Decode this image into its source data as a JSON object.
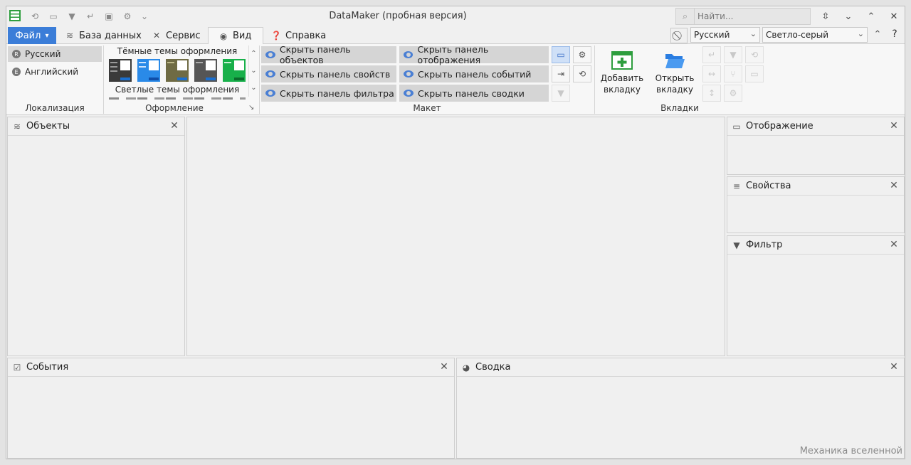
{
  "window": {
    "title": "DataMaker (пробная версия)"
  },
  "quick_access": {
    "icons": [
      "refresh-icon",
      "window-icon",
      "pin-icon",
      "return-icon",
      "chip-icon",
      "gear-icon",
      "chevron-down-icon"
    ]
  },
  "search": {
    "placeholder": "Найти..."
  },
  "menu": {
    "file": "Файл",
    "database": "База данных",
    "service": "Сервис",
    "view": "Вид",
    "help": "Справка"
  },
  "toolbar_right": {
    "language": "Русский",
    "theme": "Светло-серый",
    "help_mark": "?"
  },
  "ribbon": {
    "localization": {
      "label": "Локализация",
      "items": [
        {
          "badge": "R",
          "label": "Русский"
        },
        {
          "badge": "E",
          "label": "Английский"
        }
      ]
    },
    "appearance": {
      "label": "Оформление",
      "dark_title": "Тёмные темы оформления",
      "light_title": "Светлые темы оформления"
    },
    "layout": {
      "label": "Макет",
      "hide_objects": "Скрыть панель объектов",
      "hide_properties": "Скрыть панель свойств",
      "hide_filter": "Скрыть панель фильтра",
      "hide_display": "Скрыть панель отображения",
      "hide_events": "Скрыть панель событий",
      "hide_summary": "Скрыть панель сводки"
    },
    "tabs": {
      "label": "Вкладки",
      "add_tab": "Добавить вкладку",
      "open_tab": "Открыть вкладку"
    }
  },
  "panels": {
    "objects": "Объекты",
    "display": "Отображение",
    "properties": "Свойства",
    "filter": "Фильтр",
    "events": "События",
    "summary": "Сводка"
  },
  "status": {
    "text": "Механика вселенной"
  },
  "colors": {
    "accent": "#3b7dd8",
    "background": "#f0f0f0"
  }
}
